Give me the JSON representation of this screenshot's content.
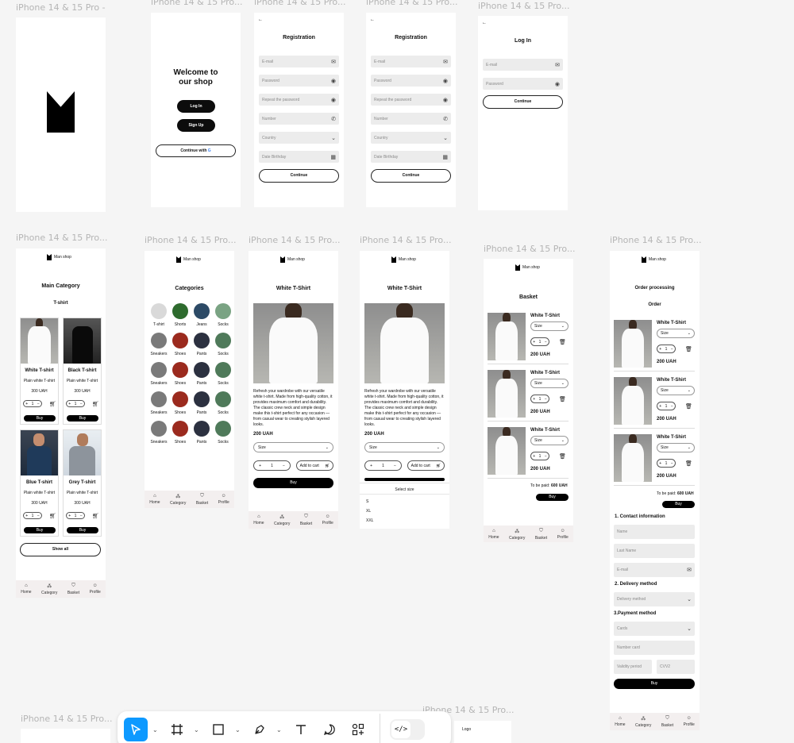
{
  "frame_label": "iPhone 14 & 15 Pro...",
  "frame_label_first": "iPhone 14 & 15 Pro -",
  "splash": {},
  "welcome": {
    "title": "Welcome to our shop",
    "login": "Log In",
    "signup": "Sign Up",
    "google": "Continue with"
  },
  "registration": {
    "title": "Registration",
    "back": "←",
    "fields": [
      "E-mail",
      "Password",
      "Repeat the password",
      "Number",
      "Country",
      "Date Birthday"
    ],
    "continue": "Continue"
  },
  "login": {
    "title": "Log In",
    "back": "←",
    "fields": [
      "E-mail",
      "Password"
    ],
    "continue": "Continue"
  },
  "brand": "Man shop",
  "main_category": {
    "title": "Main Category",
    "subtitle": "T-shirt",
    "products": [
      {
        "name": "White T-shirt",
        "desc": "Plain white T-shirt",
        "price": "300 UAH"
      },
      {
        "name": "Black T-shirt",
        "desc": "Plain white T-shirt",
        "price": "300 UAH"
      },
      {
        "name": "Blue T-shirt",
        "desc": "Plain white T-shirt",
        "price": "300 UAH"
      },
      {
        "name": "Grey T-shirt",
        "desc": "Plain white T-shirt",
        "price": "300 UAH"
      }
    ],
    "buy": "Buy",
    "qty": "1",
    "show_all": "Show all"
  },
  "categories": {
    "title": "Categories",
    "rows": [
      [
        "T-shirt",
        "Shorts",
        "Jeans",
        "Socks"
      ],
      [
        "Sneakers",
        "Shoes",
        "Pants",
        "Socks"
      ],
      [
        "Sneakers",
        "Shoes",
        "Pants",
        "Socks"
      ],
      [
        "Sneakers",
        "Shoes",
        "Pants",
        "Socks"
      ],
      [
        "Sneakers",
        "Shoes",
        "Pants",
        "Socks"
      ]
    ]
  },
  "product": {
    "title": "White T-Shirt",
    "description": "Refresh your wardrobe with our versatile white t-shirt. Made from high-quality cotton, it provides maximum comfort and durability. The classic crew neck and simple design make this t-shirt perfect for any occasion — from casual wear to creating stylish layered looks.",
    "price": "200 UAH",
    "size": "Size",
    "qty": "1",
    "add_to_cart": "Add to cart",
    "buy": "Buy",
    "select_size": "Select size",
    "sizes": [
      "S",
      "XL",
      "XXL"
    ]
  },
  "basket": {
    "title": "Basket",
    "items": [
      {
        "name": "White T-Shirt",
        "price": "200 UAH"
      },
      {
        "name": "White T-Shirt",
        "price": "200 UAH"
      },
      {
        "name": "White T-Shirt",
        "price": "200 UAH"
      }
    ],
    "size": "Size",
    "qty": "1",
    "to_be_paid_label": "To be paid:",
    "to_be_paid": "600 UAH",
    "buy": "Buy"
  },
  "order": {
    "title": "Order processing",
    "subtitle": "Order",
    "items": [
      {
        "name": "White T-Shirt",
        "price": "200 UAH"
      },
      {
        "name": "White T-Shirt",
        "price": "200 UAH"
      },
      {
        "name": "White T-Shirt",
        "price": "200 UAH"
      }
    ],
    "size": "Size",
    "qty": "1",
    "to_be_paid_label": "To be paid:",
    "to_be_paid": "600 UAH",
    "buy": "Buy",
    "contact_title": "1. Contact information",
    "contact_fields": [
      "Name",
      "Last Name",
      "E-mail"
    ],
    "delivery_title": "2. Delivery method",
    "delivery_field": "Delivery method",
    "payment_title": "3.Payment method",
    "payment_field": "Cards",
    "card_number": "Number card",
    "validity": "Validity period",
    "cvv": "CVV2",
    "final_buy": "Buy"
  },
  "nav": [
    "Home",
    "Category",
    "Basket",
    "Profile"
  ],
  "logo_frame_text": "Logo",
  "toolbar": {
    "code_icon": "</>"
  }
}
